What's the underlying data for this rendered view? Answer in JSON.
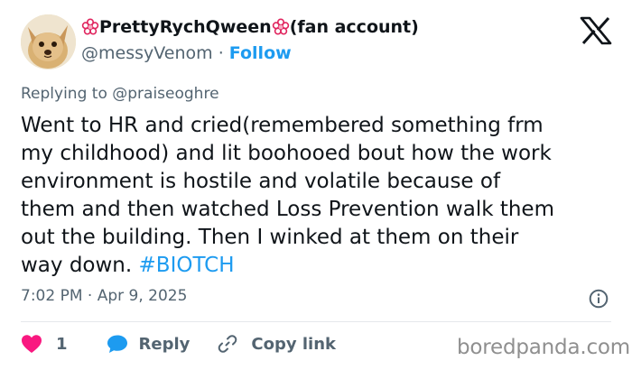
{
  "author": {
    "display_name": "PrettyRychQween",
    "suffix": "(fan account)",
    "handle": "@messyVenom",
    "separator": "·",
    "follow_label": "Follow"
  },
  "reply_context": {
    "prefix": "Replying to ",
    "handle": "@praiseoghre"
  },
  "tweet": {
    "lines": [
      "Went to HR and cried(remembered something frm",
      "my childhood) and lit boohooed bout how the work",
      "environment is hostile and volatile because of",
      "them and then watched Loss Prevention walk them",
      "out the building. Then I winked at them on their",
      "way down. "
    ],
    "hashtag": "#BIOTCH"
  },
  "meta": {
    "time": "7:02 PM",
    "separator": "·",
    "date": "Apr 9, 2025"
  },
  "actions": {
    "like_count": "1",
    "reply_label": "Reply",
    "copy_link_label": "Copy link"
  },
  "watermark": "boredpanda.com",
  "icons": {
    "avatar": "dog-avatar",
    "flower": "pink-flower-emoji-icon",
    "platform": "x-logo-icon",
    "info": "info-icon",
    "like": "heart-icon",
    "reply": "speech-bubble-icon",
    "copy": "link-icon"
  },
  "colors": {
    "text": "#0f1419",
    "secondary": "#536471",
    "accent": "#1d9bf0",
    "like": "#f91880",
    "flower": "#e0245e"
  }
}
